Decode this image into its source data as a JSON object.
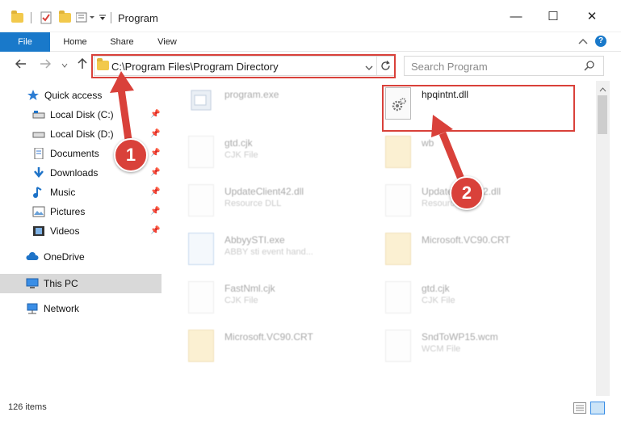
{
  "window": {
    "title": "Program",
    "controls": {
      "minimize": "—",
      "maximize": "☐",
      "close": "✕"
    }
  },
  "ribbon": {
    "tabs": [
      {
        "label": "File"
      },
      {
        "label": "Home"
      },
      {
        "label": "Share"
      },
      {
        "label": "View"
      }
    ],
    "help": "?"
  },
  "nav": {
    "address": "C:\\Program Files\\Program Directory",
    "search_placeholder": "Search Program"
  },
  "sidebar": {
    "items": [
      {
        "label": "Quick access",
        "icon": "star-icon"
      },
      {
        "label": "Local Disk (C:)",
        "icon": "drive-icon",
        "pinned": true
      },
      {
        "label": "Local Disk (D:)",
        "icon": "drive-icon",
        "pinned": true
      },
      {
        "label": "Documents",
        "icon": "documents-icon",
        "pinned": true
      },
      {
        "label": "Downloads",
        "icon": "download-icon",
        "pinned": true
      },
      {
        "label": "Music",
        "icon": "music-icon",
        "pinned": true
      },
      {
        "label": "Pictures",
        "icon": "pictures-icon",
        "pinned": true
      },
      {
        "label": "Videos",
        "icon": "videos-icon",
        "pinned": true
      },
      {
        "label": "OneDrive",
        "icon": "cloud-icon"
      },
      {
        "label": "This PC",
        "icon": "pc-icon",
        "selected": true
      },
      {
        "label": "Network",
        "icon": "network-icon"
      }
    ]
  },
  "files": [
    {
      "name": "program.exe",
      "type": ""
    },
    {
      "name": "hpqintnt.dll",
      "type": ""
    },
    {
      "name": "gtd.cjk",
      "type": "CJK File"
    },
    {
      "name": "wb",
      "type": ""
    },
    {
      "name": "UpdateClient42.dll",
      "type": "Resource DLL"
    },
    {
      "name": "UpdateClient42.dll",
      "type": "Resource DLL"
    },
    {
      "name": "AbbyySTI.exe",
      "type": "ABBY sti event hand..."
    },
    {
      "name": "Microsoft.VC90.CRT",
      "type": ""
    },
    {
      "name": "FastNml.cjk",
      "type": "CJK File"
    },
    {
      "name": "gtd.cjk",
      "type": "CJK File"
    },
    {
      "name": "Microsoft.VC90.CRT",
      "type": ""
    },
    {
      "name": "SndToWP15.wcm",
      "type": "WCM File"
    }
  ],
  "status": {
    "item_count": "126 items"
  },
  "annotations": {
    "step1": "1",
    "step2": "2"
  },
  "colors": {
    "accent": "#1979ca",
    "highlight": "#d9413a"
  }
}
